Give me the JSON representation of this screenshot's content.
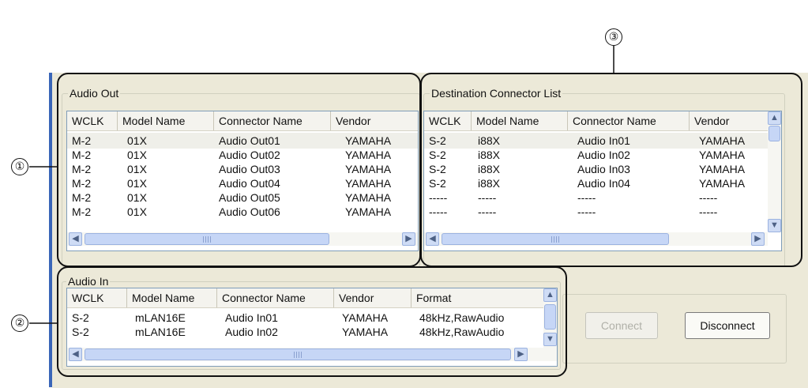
{
  "callouts": [
    "①",
    "②",
    "③"
  ],
  "audio_out": {
    "title": "Audio Out",
    "columns": [
      "WCLK",
      "Model Name",
      "Connector Name",
      "Vendor"
    ],
    "rows": [
      [
        "M-2",
        "01X",
        "Audio Out01",
        "YAMAHA"
      ],
      [
        "M-2",
        "01X",
        "Audio Out02",
        "YAMAHA"
      ],
      [
        "M-2",
        "01X",
        "Audio Out03",
        "YAMAHA"
      ],
      [
        "M-2",
        "01X",
        "Audio Out04",
        "YAMAHA"
      ],
      [
        "M-2",
        "01X",
        "Audio Out05",
        "YAMAHA"
      ],
      [
        "M-2",
        "01X",
        "Audio Out06",
        "YAMAHA"
      ]
    ]
  },
  "destination": {
    "title": "Destination Connector List",
    "columns": [
      "WCLK",
      "Model Name",
      "Connector Name",
      "Vendor"
    ],
    "rows": [
      [
        "S-2",
        "i88X",
        "Audio In01",
        "YAMAHA"
      ],
      [
        "S-2",
        "i88X",
        "Audio In02",
        "YAMAHA"
      ],
      [
        "S-2",
        "i88X",
        "Audio In03",
        "YAMAHA"
      ],
      [
        "S-2",
        "i88X",
        "Audio In04",
        "YAMAHA"
      ],
      [
        "-----",
        "-----",
        "-----",
        "-----"
      ],
      [
        "-----",
        "-----",
        "-----",
        "-----"
      ]
    ]
  },
  "audio_in": {
    "title": "Audio In",
    "columns": [
      "WCLK",
      "Model Name",
      "Connector Name",
      "Vendor",
      "Format"
    ],
    "rows": [
      [
        "S-2",
        "mLAN16E",
        "Audio In01",
        "YAMAHA",
        "48kHz,RawAudio"
      ],
      [
        "S-2",
        "mLAN16E",
        "Audio In02",
        "YAMAHA",
        "48kHz,RawAudio"
      ]
    ]
  },
  "buttons": {
    "connect": "Connect",
    "disconnect": "Disconnect"
  },
  "icons": {
    "scroll_left": "scroll-left-icon",
    "scroll_right": "scroll-right-icon",
    "scroll_up": "scroll-up-icon",
    "scroll_down": "scroll-down-icon"
  }
}
